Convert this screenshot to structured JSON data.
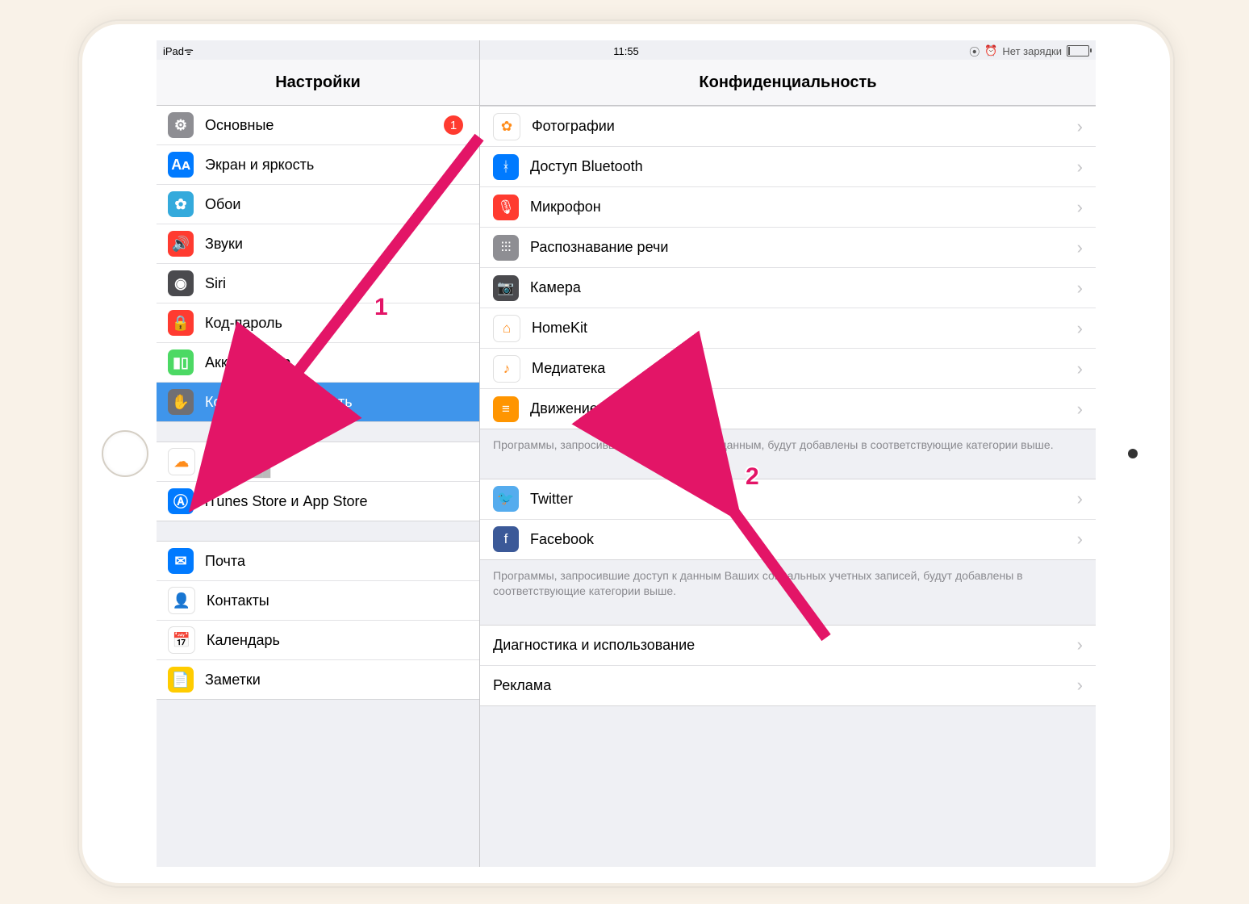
{
  "statusbar": {
    "device": "iPad",
    "time": "11:55",
    "battery": "Нет зарядки"
  },
  "left": {
    "header": "Настройки",
    "groups": [
      {
        "rows": [
          {
            "id": "general",
            "icon": "gear",
            "bg": "c-gray",
            "label": "Основные",
            "badge": "1"
          },
          {
            "id": "display",
            "icon": "AᴀA",
            "bg": "c-blue",
            "label": "Экран и яркость"
          },
          {
            "id": "wallpaper",
            "icon": "flower",
            "bg": "c-lblue",
            "label": "Обои"
          },
          {
            "id": "sounds",
            "icon": "speaker",
            "bg": "c-red",
            "label": "Звуки"
          },
          {
            "id": "siri",
            "icon": "siri",
            "bg": "c-darkgray",
            "label": "Siri"
          },
          {
            "id": "passcode",
            "icon": "lock",
            "bg": "c-red",
            "label": "Код-пароль"
          },
          {
            "id": "battery",
            "icon": "batt",
            "bg": "c-green",
            "label": "Аккумулятор"
          },
          {
            "id": "privacy",
            "icon": "hand",
            "bg": "c-dgray",
            "label": "Конфиденциальность",
            "selected": true
          }
        ]
      },
      {
        "rows": [
          {
            "id": "icloud",
            "icon": "cloud",
            "bg": "c-white",
            "label": "iCloud",
            "subtitle": "████████"
          },
          {
            "id": "itunes",
            "icon": "appstore",
            "bg": "c-blue",
            "label": "iTunes Store и App Store"
          }
        ]
      },
      {
        "rows": [
          {
            "id": "mail",
            "icon": "mail",
            "bg": "c-blue",
            "label": "Почта"
          },
          {
            "id": "contacts",
            "icon": "contacts",
            "bg": "c-white",
            "label": "Контакты"
          },
          {
            "id": "calendar",
            "icon": "cal",
            "bg": "c-white",
            "label": "Календарь"
          },
          {
            "id": "notes",
            "icon": "notes",
            "bg": "c-yellow",
            "label": "Заметки"
          }
        ]
      }
    ]
  },
  "right": {
    "header": "Конфиденциальность",
    "sections": [
      {
        "type": "block",
        "rows": [
          {
            "id": "photos",
            "icon": "photos",
            "bg": "c-white",
            "label": "Фотографии"
          },
          {
            "id": "bluetooth",
            "icon": "bt",
            "bg": "c-blue",
            "label": "Доступ Bluetooth"
          },
          {
            "id": "mic",
            "icon": "mic",
            "bg": "c-red",
            "label": "Микрофон"
          },
          {
            "id": "speech",
            "icon": "wave",
            "bg": "c-gray",
            "label": "Распознавание речи"
          },
          {
            "id": "camera",
            "icon": "cam",
            "bg": "c-darkgray",
            "label": "Камера"
          },
          {
            "id": "homekit",
            "icon": "home",
            "bg": "c-white",
            "label": "HomeKit"
          },
          {
            "id": "media",
            "icon": "music",
            "bg": "c-white",
            "label": "Медиатека"
          },
          {
            "id": "fitness",
            "icon": "fitness",
            "bg": "c-orange",
            "label": "Движение и фитнес"
          }
        ]
      },
      {
        "type": "footnote",
        "text": "Программы, запросившие доступ к Вашим данным, будут добавлены в соответствующие категории выше."
      },
      {
        "type": "block",
        "rows": [
          {
            "id": "twitter",
            "icon": "tw",
            "bg": "c-tw",
            "label": "Twitter"
          },
          {
            "id": "facebook",
            "icon": "fb",
            "bg": "c-fb",
            "label": "Facebook"
          }
        ]
      },
      {
        "type": "footnote",
        "text": "Программы, запросившие доступ к данным Ваших социальных учетных записей, будут добавлены в соответствующие категории выше."
      },
      {
        "type": "block",
        "rows": [
          {
            "id": "diag",
            "label": "Диагностика и использование",
            "noicon": true
          },
          {
            "id": "ads",
            "label": "Реклама",
            "noicon": true
          }
        ]
      }
    ]
  },
  "anno": {
    "one": "1",
    "two": "2"
  }
}
